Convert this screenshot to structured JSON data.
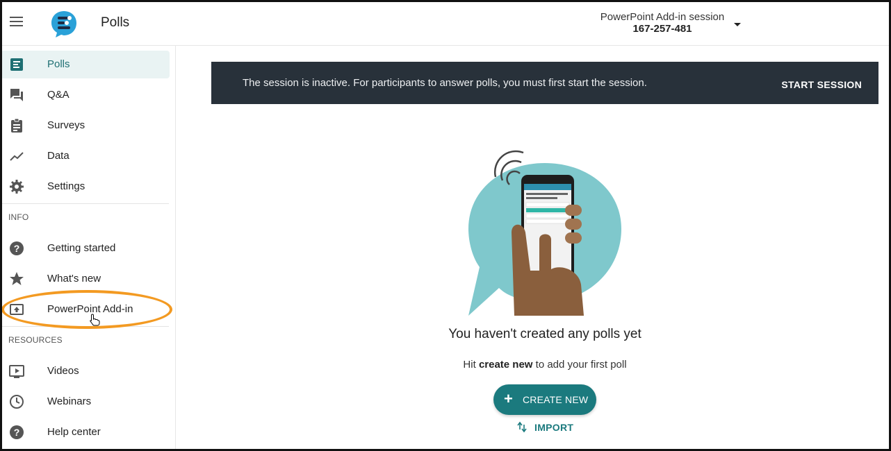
{
  "header": {
    "app_title": "Polls",
    "session_name": "PowerPoint Add-in session",
    "session_id": "167-257-481"
  },
  "sidebar": {
    "main_items": [
      {
        "label": "Polls",
        "icon": "polls-icon",
        "active": true
      },
      {
        "label": "Q&A",
        "icon": "chat-icon"
      },
      {
        "label": "Surveys",
        "icon": "clipboard-icon"
      },
      {
        "label": "Data",
        "icon": "trend-icon"
      },
      {
        "label": "Settings",
        "icon": "gear-icon"
      }
    ],
    "info_heading": "INFO",
    "info_items": [
      {
        "label": "Getting started",
        "icon": "help-icon"
      },
      {
        "label": "What's new",
        "icon": "star-icon"
      },
      {
        "label": "PowerPoint Add-in",
        "icon": "upload-box-icon"
      }
    ],
    "resources_heading": "RESOURCES",
    "resource_items": [
      {
        "label": "Videos",
        "icon": "video-icon"
      },
      {
        "label": "Webinars",
        "icon": "clock-icon"
      },
      {
        "label": "Help center",
        "icon": "help-icon"
      }
    ]
  },
  "banner": {
    "message": "The session is inactive. For participants to answer polls, you must first start the session.",
    "action": "START SESSION"
  },
  "empty_state": {
    "title": "You haven't created any polls yet",
    "sub_prefix": "Hit",
    "sub_bold": "create new",
    "sub_suffix": "to add your first poll",
    "create_label": "CREATE NEW",
    "import_label": "IMPORT"
  },
  "colors": {
    "accent": "#1b7a7e",
    "banner_bg": "#28313a",
    "highlight": "#f39a22",
    "active_bg": "#e9f3f3"
  }
}
